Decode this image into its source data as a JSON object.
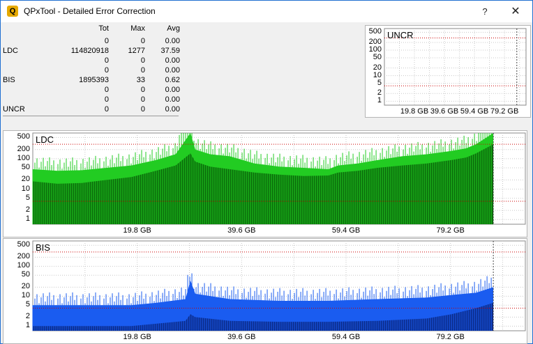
{
  "window": {
    "title": "QPxTool - Detailed Error Correction",
    "help_label": "?",
    "close_label": "✕",
    "app_icon": "Q"
  },
  "stats": {
    "headers": {
      "tot": "Tot",
      "max": "Max",
      "avg": "Avg"
    },
    "rows": [
      {
        "label": "",
        "tot": "0",
        "max": "0",
        "avg": "0.00"
      },
      {
        "label": "LDC",
        "tot": "114820918",
        "max": "1277",
        "avg": "37.59"
      },
      {
        "label": "",
        "tot": "0",
        "max": "0",
        "avg": "0.00"
      },
      {
        "label": "",
        "tot": "0",
        "max": "0",
        "avg": "0.00"
      },
      {
        "label": "BIS",
        "tot": "1895393",
        "max": "33",
        "avg": "0.62"
      },
      {
        "label": "",
        "tot": "0",
        "max": "0",
        "avg": "0.00"
      },
      {
        "label": "",
        "tot": "0",
        "max": "0",
        "avg": "0.00"
      },
      {
        "label": "UNCR",
        "tot": "0",
        "max": "0",
        "avg": "0.00"
      }
    ]
  },
  "chart_data": [
    {
      "type": "area",
      "title": "UNCR",
      "y_scale": "log",
      "y_ticks": [
        "500",
        "200",
        "100",
        "50",
        "20",
        "10",
        "5",
        "2",
        "1"
      ],
      "x_ticks": [
        "19.8 GB",
        "39.6 GB",
        "59.4 GB",
        "79.2 GB"
      ],
      "xlim": [
        0,
        100
      ],
      "series": [
        {
          "color": "#00a000",
          "x": [
            0,
            100
          ],
          "y": [
            0,
            0
          ]
        }
      ]
    },
    {
      "type": "area",
      "title": "LDC",
      "y_scale": "log",
      "y_ticks": [
        "500",
        "200",
        "100",
        "50",
        "20",
        "10",
        "5",
        "2",
        "1"
      ],
      "x_ticks": [
        "19.8 GB",
        "39.6 GB",
        "59.4 GB",
        "79.2 GB"
      ],
      "xlim": [
        0,
        100
      ],
      "colors": {
        "peak": "#22cc22",
        "avg": "#0a6b0a",
        "threshold": "#cc0000"
      },
      "thresholds": [
        300,
        4
      ],
      "series": [
        {
          "name": "",
          "x": [
            0,
            5,
            10,
            15,
            20,
            25,
            29,
            32,
            33,
            36,
            40,
            45,
            50,
            55,
            60,
            62,
            66,
            70,
            75,
            80,
            85,
            88,
            90,
            93.5
          ],
          "y": [
            45,
            40,
            42,
            50,
            60,
            90,
            140,
            900,
            200,
            140,
            120,
            70,
            55,
            50,
            45,
            60,
            70,
            90,
            120,
            140,
            180,
            220,
            300,
            1277
          ]
        },
        {
          "name": "",
          "x": [
            0,
            5,
            10,
            15,
            20,
            25,
            29,
            32,
            33,
            36,
            40,
            45,
            50,
            55,
            60,
            62,
            66,
            70,
            75,
            80,
            85,
            88,
            90,
            93.5
          ],
          "y": [
            18,
            15,
            16,
            20,
            25,
            40,
            60,
            150,
            80,
            55,
            45,
            35,
            30,
            27,
            28,
            35,
            40,
            50,
            60,
            70,
            90,
            110,
            150,
            300
          ]
        }
      ]
    },
    {
      "type": "area",
      "title": "BIS",
      "y_scale": "log",
      "y_ticks": [
        "500",
        "200",
        "100",
        "50",
        "20",
        "10",
        "5",
        "2",
        "1"
      ],
      "x_ticks": [
        "19.8 GB",
        "39.6 GB",
        "59.4 GB",
        "79.2 GB"
      ],
      "xlim": [
        0,
        100
      ],
      "colors": {
        "peak": "#1a5cf0",
        "avg": "#0b2b8a",
        "threshold": "#cc0000"
      },
      "thresholds": [
        300,
        4
      ],
      "series": [
        {
          "name": "",
          "x": [
            0,
            10,
            20,
            25,
            31,
            32,
            33,
            40,
            50,
            60,
            70,
            80,
            85,
            90,
            93.5
          ],
          "y": [
            5,
            5,
            5,
            6,
            8,
            33,
            12,
            8,
            7,
            7,
            8,
            9,
            11,
            13,
            20
          ]
        },
        {
          "name": "",
          "x": [
            0,
            10,
            20,
            25,
            31,
            32,
            33,
            40,
            50,
            60,
            70,
            80,
            85,
            90,
            93.5
          ],
          "y": [
            1,
            1,
            1,
            1.2,
            1.5,
            2.5,
            2,
            1.5,
            1.4,
            1.4,
            1.5,
            1.8,
            2.5,
            4,
            6
          ]
        }
      ]
    }
  ]
}
